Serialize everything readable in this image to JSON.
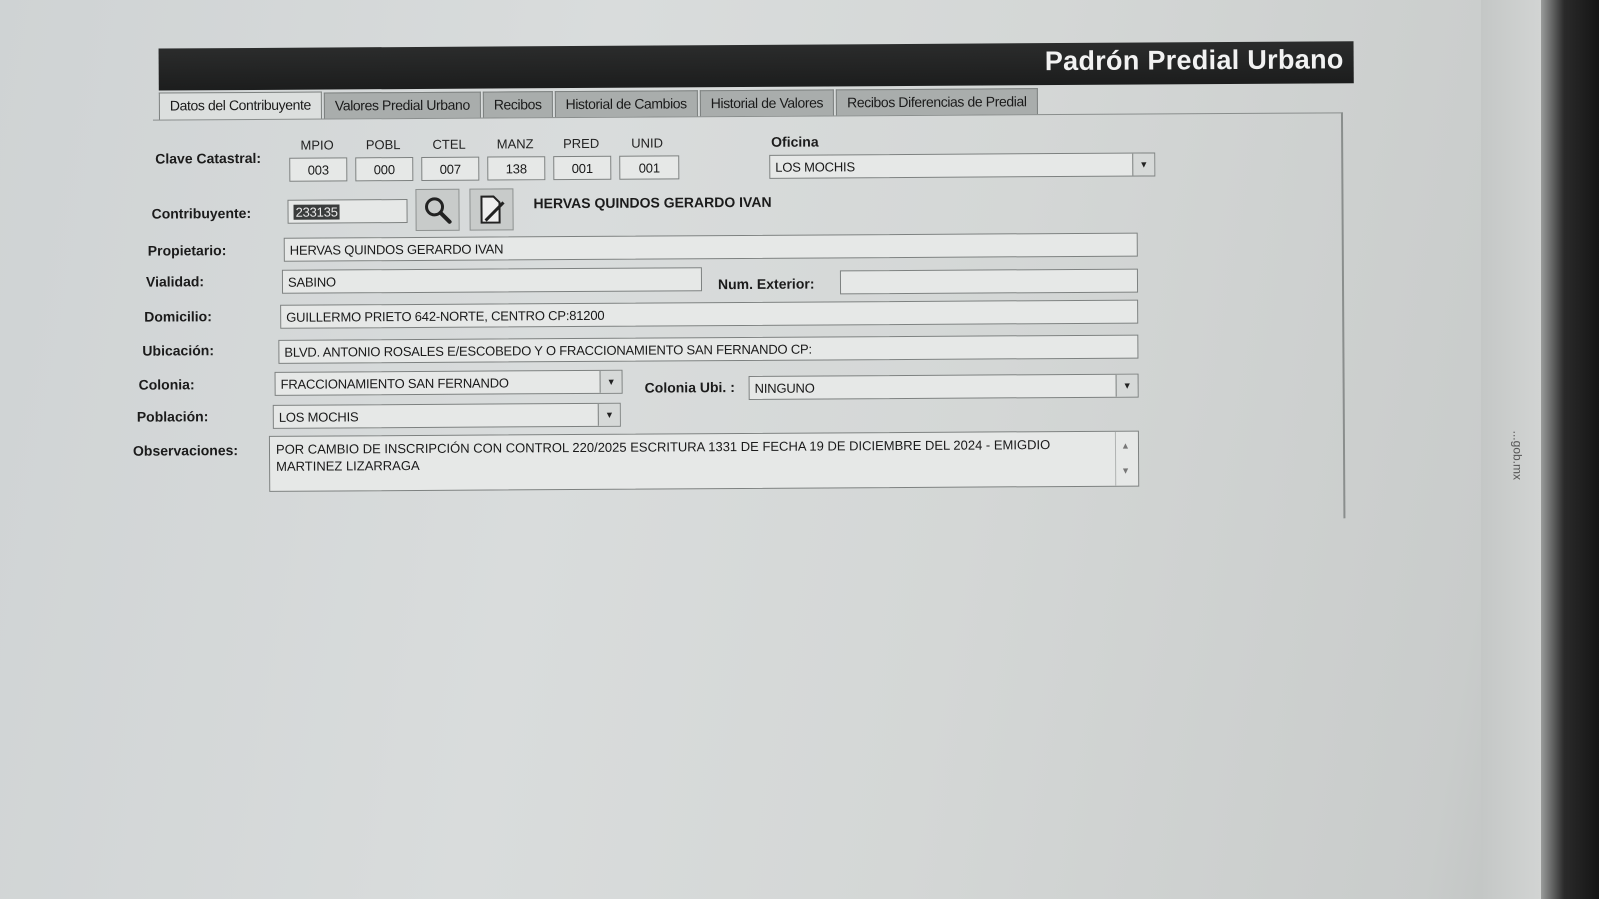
{
  "window": {
    "title": "Padrón Predial Urbano"
  },
  "tabs": [
    {
      "label": "Datos del Contribuyente",
      "active": true
    },
    {
      "label": "Valores Predial Urbano",
      "active": false
    },
    {
      "label": "Recibos",
      "active": false
    },
    {
      "label": "Historial de Cambios",
      "active": false
    },
    {
      "label": "Historial de Valores",
      "active": false
    },
    {
      "label": "Recibos Diferencias de Predial",
      "active": false
    }
  ],
  "clave_catastral": {
    "label": "Clave Catastral:",
    "fields": [
      {
        "header": "MPIO",
        "value": "003"
      },
      {
        "header": "POBL",
        "value": "000"
      },
      {
        "header": "CTEL",
        "value": "007"
      },
      {
        "header": "MANZ",
        "value": "138"
      },
      {
        "header": "PRED",
        "value": "001"
      },
      {
        "header": "UNID",
        "value": "001"
      }
    ]
  },
  "oficina": {
    "label": "Oficina",
    "value": "LOS MOCHIS"
  },
  "contribuyente": {
    "label": "Contribuyente:",
    "value": "233135",
    "name": "HERVAS QUINDOS GERARDO IVAN"
  },
  "propietario": {
    "label": "Propietario:",
    "value": "HERVAS QUINDOS GERARDO IVAN"
  },
  "vialidad": {
    "label": "Vialidad:",
    "value": "SABINO"
  },
  "num_exterior": {
    "label": "Num. Exterior:",
    "value": ""
  },
  "domicilio": {
    "label": "Domicilio:",
    "value": "GUILLERMO PRIETO  642-NORTE, CENTRO CP:81200"
  },
  "ubicacion": {
    "label": "Ubicación:",
    "value": "BLVD. ANTONIO ROSALES E/ESCOBEDO Y O  FRACCIONAMIENTO SAN FERNANDO CP:"
  },
  "colonia": {
    "label": "Colonia:",
    "value": "FRACCIONAMIENTO SAN FERNANDO"
  },
  "colonia_ubi": {
    "label": "Colonia Ubi. :",
    "value": "NINGUNO"
  },
  "poblacion": {
    "label": "Población:",
    "value": "LOS MOCHIS"
  },
  "observaciones": {
    "label": "Observaciones:",
    "value": "POR CAMBIO DE INSCRIPCIÓN CON CONTROL 220/2025 ESCRITURA 1331 DE FECHA 19 DE DICIEMBRE DEL 2024 - EMIGDIO MARTINEZ LIZARRAGA"
  },
  "edge": {
    "text": "...gob.mx"
  }
}
